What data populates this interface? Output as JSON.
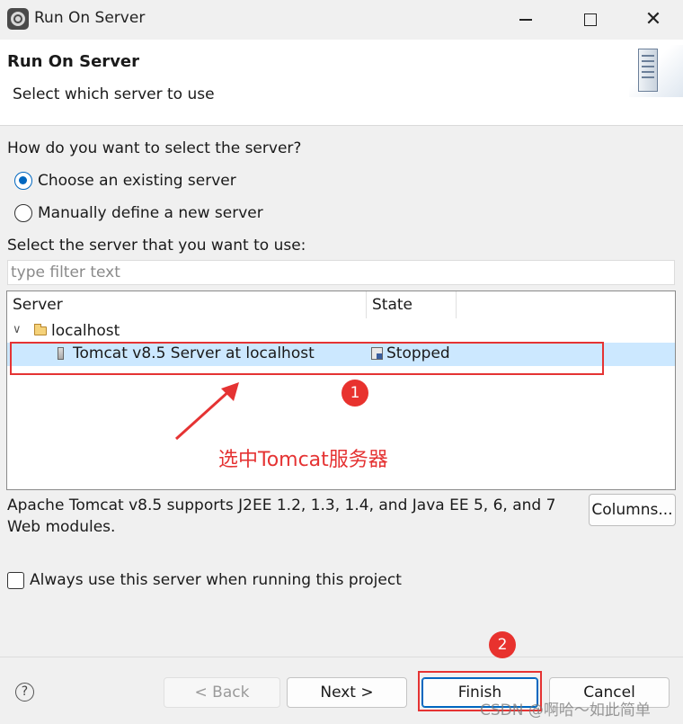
{
  "window": {
    "title": "Run On Server"
  },
  "header": {
    "title": "Run On Server",
    "subtitle": "Select which server to use"
  },
  "selection": {
    "question": "How do you want to select the server?",
    "options": [
      {
        "label": "Choose an existing server",
        "selected": true
      },
      {
        "label": "Manually define a new server",
        "selected": false
      }
    ],
    "server_prompt": "Select the server that you want to use:",
    "filter_placeholder": "type filter text"
  },
  "table": {
    "columns": [
      "Server",
      "State"
    ],
    "group": "localhost",
    "rows": [
      {
        "server": "Tomcat v8.5 Server at localhost",
        "state": "Stopped",
        "selected": true
      }
    ]
  },
  "description": "Apache Tomcat v8.5 supports J2EE 1.2, 1.3, 1.4, and Java EE 5, 6, and 7 Web modules.",
  "columns_button": "Columns...",
  "always_use": {
    "label": "Always use this server when running this project",
    "checked": false
  },
  "footer": {
    "help": "?",
    "back": "< Back",
    "next": "Next >",
    "finish": "Finish",
    "cancel": "Cancel"
  },
  "annotations": {
    "badge1": "1",
    "badge2": "2",
    "note": "选中Tomcat服务器",
    "color": "#e53333"
  },
  "watermark": "CSDN @啊哈～如此简单",
  "icons": [
    "app-icon",
    "server-graphic-icon",
    "folder-icon",
    "server-icon",
    "stopped-icon",
    "help-icon"
  ]
}
